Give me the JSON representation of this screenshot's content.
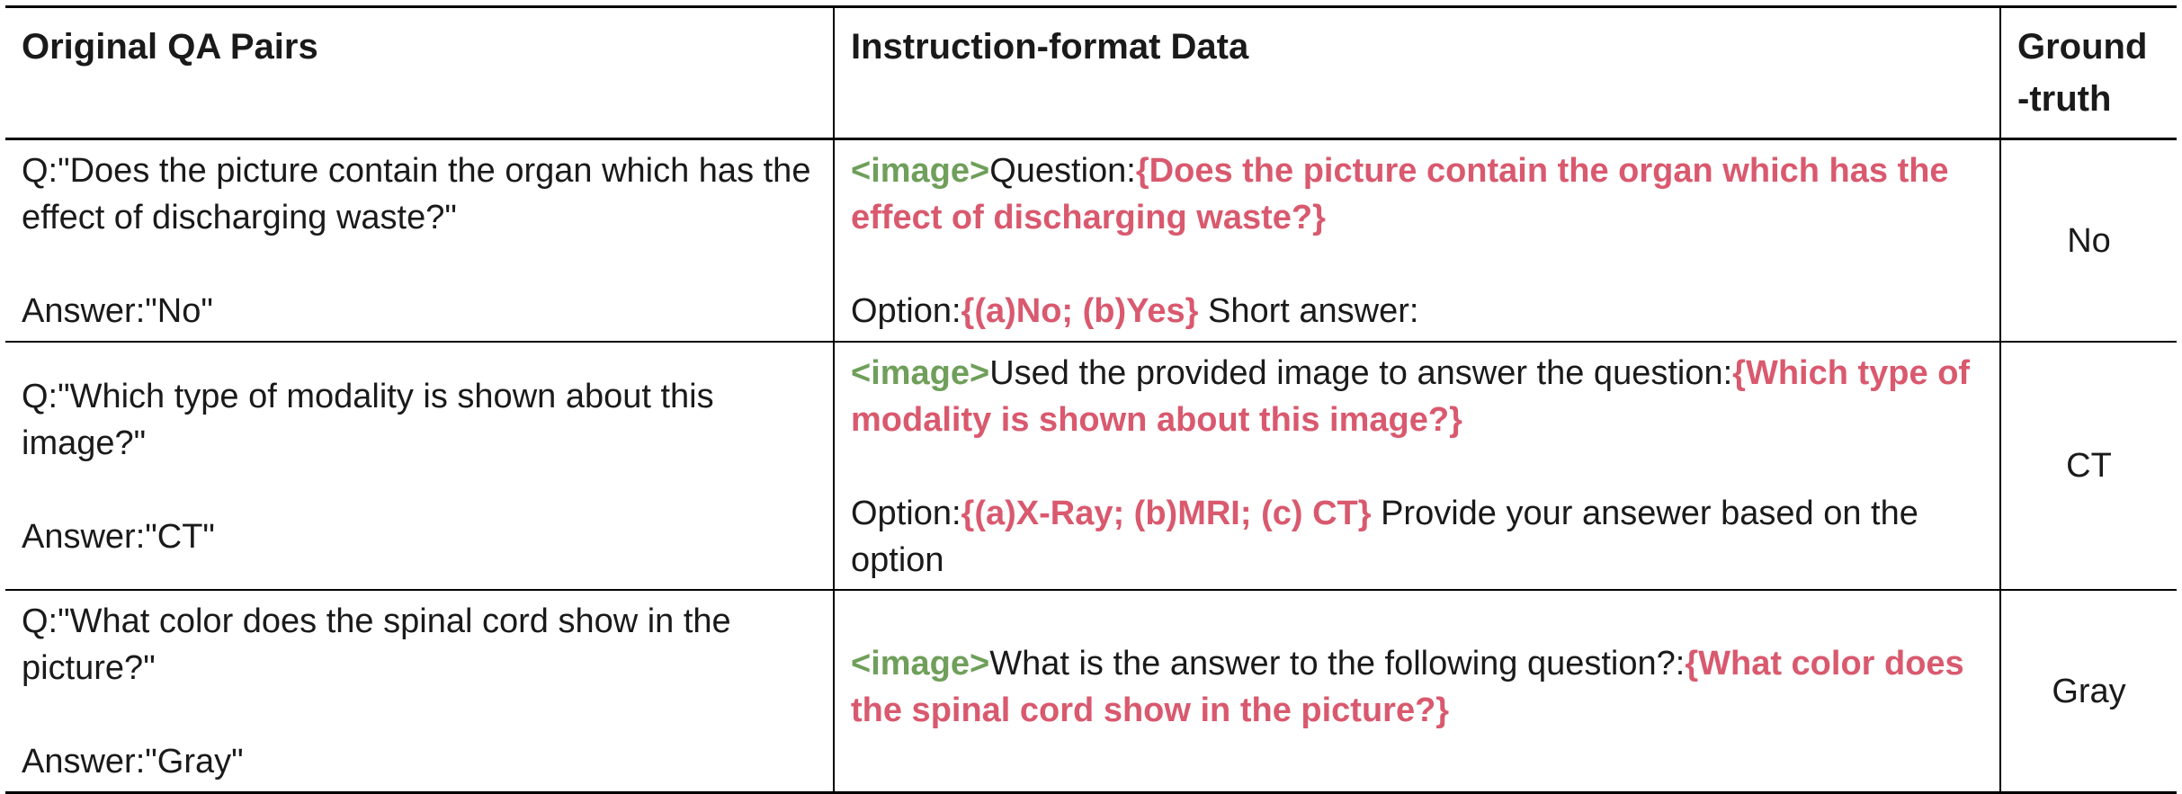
{
  "headers": {
    "qa": "Original QA Pairs",
    "instruction": "Instruction-format Data",
    "ground_truth_line1": "Ground",
    "ground_truth_line2": "-truth"
  },
  "rows": [
    {
      "question": "Q:\"Does the picture contain the organ which has the effect of discharging waste?\"",
      "answer": "Answer:\"No\"",
      "image_tag": "<image>",
      "prompt_prefix": "Question:",
      "question_braced": "{Does the picture contain the organ which has the effect of discharging waste?}",
      "option_label": "Option:",
      "options_braced": "{(a)No; (b)Yes}",
      "option_suffix": " Short answer:",
      "ground_truth": "No"
    },
    {
      "question": "Q:\"Which type of modality is shown about this image?\"",
      "answer": "Answer:\"CT\"",
      "image_tag": "<image>",
      "prompt_prefix": "Used the provided image to answer the question:",
      "question_braced": "{Which type of modality is shown about this image?}",
      "option_label": "Option:",
      "options_braced": "{(a)X-Ray; (b)MRI; (c) CT}",
      "option_suffix": " Provide your ansewer based on the option",
      "ground_truth": "CT"
    },
    {
      "question": "Q:\"What color does the spinal cord show in the picture?\"",
      "answer": "Answer:\"Gray\"",
      "image_tag": "<image>",
      "prompt_prefix": "What is the answer to the following question?:",
      "question_braced": "{What color does the spinal cord show in the picture?}",
      "ground_truth": "Gray"
    }
  ],
  "colors": {
    "image_tag": "#6f9f5a",
    "highlight": "#d9596e",
    "text": "#1a1a1a",
    "rule": "#000000"
  }
}
